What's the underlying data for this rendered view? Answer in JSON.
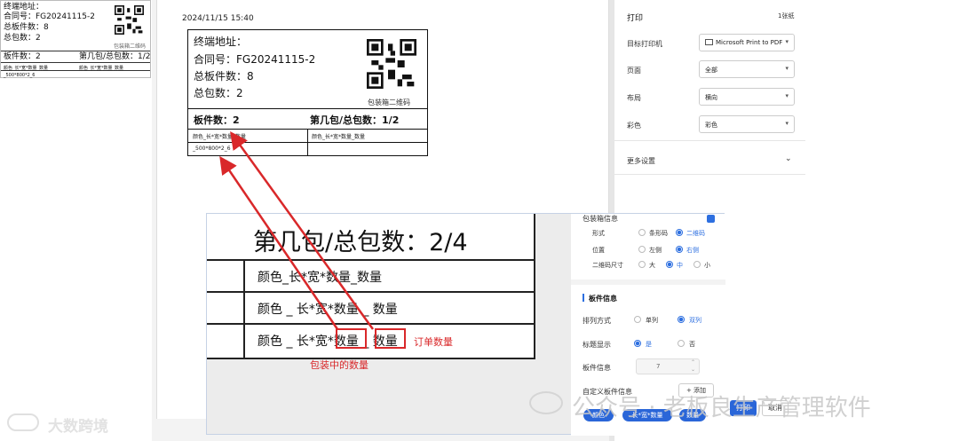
{
  "mini_label": {
    "address": "终端地址：",
    "contract": "合同号：FG20241115-2",
    "boards": "总板件数：8",
    "packages": "总包数：2",
    "qr_caption": "包装箱二维码",
    "board_count": "板件数：2",
    "pkg_of_total": "第几包/总包数：1/2",
    "col1": "颜色_长*宽*数量_数量",
    "col2": "颜色_长*宽*数量_数量",
    "row_value": "_500*800*2_6"
  },
  "preview": {
    "timestamp": "2024/11/15 15:40",
    "address": "终端地址：",
    "contract": "合同号：FG20241115-2",
    "boards": "总板件数：8",
    "packages": "总包数：2",
    "qr_caption": "包装箱二维码",
    "board_count": "板件数：2",
    "pkg_of_total": "第几包/总包数：1/2",
    "col1": "颜色_长*宽*数量_数量",
    "col2": "颜色_长*宽*数量_数量",
    "row_value": "_500*800*2_6"
  },
  "print_settings": {
    "title": "打印",
    "sheet_count": "1张纸",
    "printer_label": "目标打印机",
    "printer_value": "Microsoft Print to PDF",
    "pages_label": "页面",
    "pages_value": "全部",
    "layout_label": "布局",
    "layout_value": "横向",
    "color_label": "彩色",
    "color_value": "彩色",
    "more_settings": "更多设置"
  },
  "zoom": {
    "heading": "第几包/总包数：2/4",
    "row1": "颜色_长*宽*数量_数量",
    "row2": "颜色 _ 长*宽*数量 _ 数量",
    "row3": "颜色 _ 长*宽*数量 _ 数量",
    "annotation_order_qty": "订单数量",
    "annotation_pkg_qty": "包装中的数量"
  },
  "side_panel": {
    "pkg_info": "包装箱信息",
    "form_label": "形式",
    "form_opt1": "条形码",
    "form_opt2": "二维码",
    "pos_label": "位置",
    "pos_opt1": "左侧",
    "pos_opt2": "右侧",
    "qr_size_label": "二维码尺寸",
    "size_opt1": "大",
    "size_opt2": "中",
    "size_opt3": "小",
    "board_info_heading": "板件信息",
    "arrange_label": "排列方式",
    "arrange_opt1": "单列",
    "arrange_opt2": "双列",
    "title_show_label": "标题显示",
    "title_opt1": "是",
    "title_opt2": "否",
    "board_info_label": "板件信息",
    "board_info_value": "7",
    "custom_label": "自定义板件信息",
    "add_button": "+ 添加",
    "tag1": "颜色",
    "tag2": "长*宽*数量",
    "tag3": "数量",
    "print_button": "打印",
    "cancel_button": "取消"
  },
  "watermarks": {
    "left": "大数跨境",
    "right": "公众号 · 老板良生产管理软件"
  },
  "colors": {
    "accent": "#2a66d8",
    "annotation": "#d9282a"
  }
}
